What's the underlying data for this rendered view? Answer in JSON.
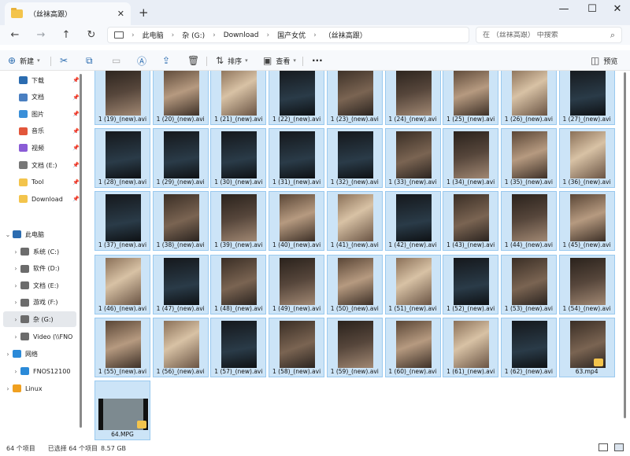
{
  "window": {
    "tab_title": "（丝袜高跟）",
    "new_tab": "+",
    "minimize": "—",
    "maximize": "☐",
    "close": "✕"
  },
  "address": {
    "crumbs": [
      "此电脑",
      "杂 (G:)",
      "Download",
      "国产女优",
      "（丝袜高跟）"
    ],
    "search_placeholder": "在 （丝袜高跟） 中搜索"
  },
  "toolbar": {
    "new_label": "新建",
    "sort_label": "排序",
    "view_label": "查看",
    "more_label": "···",
    "preview_label": "预览"
  },
  "sidebar": {
    "quick": [
      {
        "label": "下载",
        "icon": "download-icon",
        "color": "#2b6cb0"
      },
      {
        "label": "文档",
        "icon": "document-icon",
        "color": "#4a7fc1"
      },
      {
        "label": "图片",
        "icon": "picture-icon",
        "color": "#3a8fd8"
      },
      {
        "label": "音乐",
        "icon": "music-icon",
        "color": "#e2563b"
      },
      {
        "label": "视频",
        "icon": "video-icon",
        "color": "#8a5cd6"
      },
      {
        "label": "文档 (E:)",
        "icon": "drive-icon",
        "color": "#777777"
      },
      {
        "label": "Tool",
        "icon": "folder-icon",
        "color": "#f3c44c"
      },
      {
        "label": "Download",
        "icon": "folder-icon",
        "color": "#f3c44c"
      }
    ],
    "this_pc": "此电脑",
    "drives": [
      {
        "label": "系统 (C:)"
      },
      {
        "label": "软件 (D:)"
      },
      {
        "label": "文档 (E:)"
      },
      {
        "label": "游戏 (F:)"
      },
      {
        "label": "杂 (G:)"
      },
      {
        "label": "Video (\\\\FNO"
      }
    ],
    "network": "网络",
    "nas": "FNOS12100",
    "linux": "Linux"
  },
  "files": [
    "1 (19)_(new).avi",
    "1 (20)_(new).avi",
    "1 (21)_(new).avi",
    "1 (22)_(new).avi",
    "1 (23)_(new).avi",
    "1 (24)_(new).avi",
    "1 (25)_(new).avi",
    "1 (26)_(new).avi",
    "1 (27)_(new).avi",
    "1 (28)_(new).avi",
    "1 (29)_(new).avi",
    "1 (30)_(new).avi",
    "1 (31)_(new).avi",
    "1 (32)_(new).avi",
    "1 (33)_(new).avi",
    "1 (34)_(new).avi",
    "1 (35)_(new).avi",
    "1 (36)_(new).avi",
    "1 (37)_(new).avi",
    "1 (38)_(new).avi",
    "1 (39)_(new).avi",
    "1 (40)_(new).avi",
    "1 (41)_(new).avi",
    "1 (42)_(new).avi",
    "1 (43)_(new).avi",
    "1 (44)_(new).avi",
    "1 (45)_(new).avi",
    "1 (46)_(new).avi",
    "1 (47)_(new).avi",
    "1 (48)_(new).avi",
    "1 (49)_(new).avi",
    "1 (50)_(new).avi",
    "1 (51)_(new).avi",
    "1 (52)_(new).avi",
    "1 (53)_(new).avi",
    "1 (54)_(new).avi",
    "1 (55)_(new).avi",
    "1 (56)_(new).avi",
    "1 (57)_(new).avi",
    "1 (58)_(new).avi",
    "1 (59)_(new).avi",
    "1 (60)_(new).avi",
    "1 (61)_(new).avi",
    "1 (62)_(new).avi",
    "63.mp4",
    "64.MPG"
  ],
  "status": {
    "count": "64 个项目",
    "selected": "已选择 64 个项目",
    "size": "8.57 GB"
  }
}
